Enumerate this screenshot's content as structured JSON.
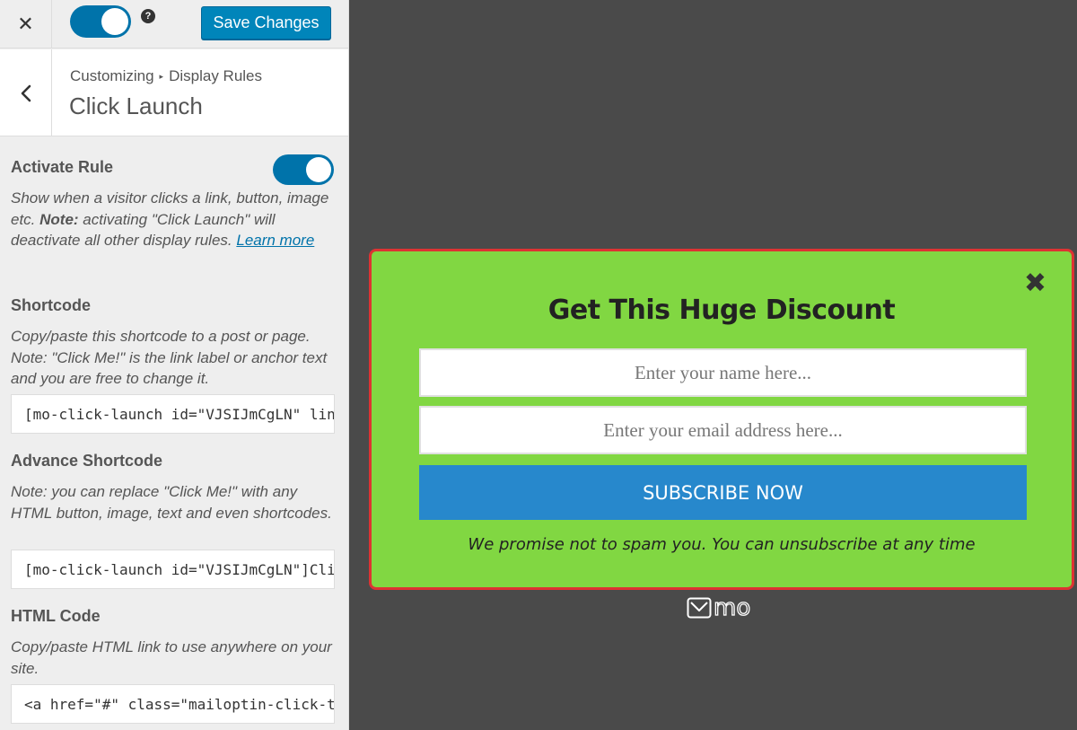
{
  "topbar": {
    "close_glyph": "✕",
    "help_glyph": "?",
    "save_label": "Save Changes"
  },
  "header": {
    "breadcrumb_parent": "Customizing",
    "breadcrumb_sep": "▸",
    "breadcrumb_current": "Display Rules",
    "title": "Click Launch"
  },
  "activate_rule": {
    "title": "Activate Rule",
    "desc_part1": "Show when a visitor clicks a link, button, image etc. ",
    "desc_note": "Note:",
    "desc_part2": " activating \"Click Launch\" will deactivate all other display rules. ",
    "learn_more": "Learn more",
    "toggle_on": true
  },
  "shortcode": {
    "title": "Shortcode",
    "desc": "Copy/paste this shortcode to a post or page. Note: \"Click Me!\" is the link label or anchor text and you are free to change it.",
    "value": "[mo-click-launch id=\"VJSIJmCgLN\" link"
  },
  "advance_shortcode": {
    "title": "Advance Shortcode",
    "desc": "Note: you can replace \"Click Me!\" with any HTML button, image, text and even shortcodes.",
    "value": "[mo-click-launch id=\"VJSIJmCgLN\"]Clic"
  },
  "html_code": {
    "title": "HTML Code",
    "desc": "Copy/paste HTML link to use anywhere on your site.",
    "value": "<a href=\"#\" class=\"mailoptin-click-trigg"
  },
  "popup": {
    "close_glyph": "✖",
    "title": "Get This Huge Discount",
    "name_placeholder": "Enter your name here...",
    "email_placeholder": "Enter your email address here...",
    "subscribe_label": "SUBSCRIBE NOW",
    "note": "We promise not to spam you. You can unsubscribe at any time",
    "brand_text": "mo",
    "colors": {
      "background": "#81d742",
      "border": "#dd3333",
      "button": "#2788cc"
    }
  },
  "colors": {
    "accent": "#0073aa",
    "save_button": "#0085ba",
    "preview_background": "#4a4a4a"
  }
}
